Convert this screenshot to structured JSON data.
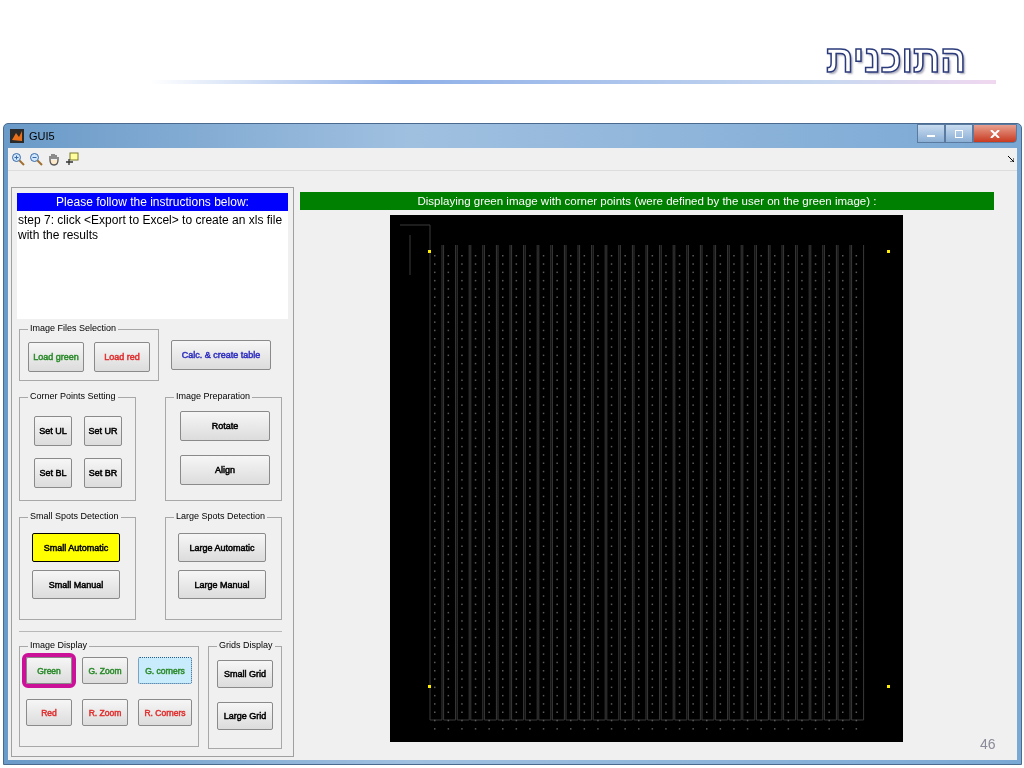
{
  "slide_title": "התוכנית",
  "window": {
    "title": "GUI5"
  },
  "instructions": {
    "header": "Please follow the instructions below:",
    "text": "step 7: click <Export to Excel> to create an xls file with the results"
  },
  "groups": [
    {
      "title": "Image Files Selection",
      "buttons": [
        {
          "label": "Load green",
          "color": "#2e8b2e",
          "kind": "normal"
        },
        {
          "label": "Load red",
          "color": "#e03030",
          "kind": "normal"
        }
      ]
    },
    {
      "buttons": [
        {
          "label": "Calc. & create table",
          "color": "#3030c0",
          "kind": "normal"
        }
      ]
    },
    {
      "title": "Corner Points Setting",
      "buttons": [
        {
          "label": "Set UL",
          "color": "#000000",
          "kind": "normal"
        },
        {
          "label": "Set UR",
          "color": "#000000",
          "kind": "normal"
        },
        {
          "label": "Set BL",
          "color": "#000000",
          "kind": "normal"
        },
        {
          "label": "Set BR",
          "color": "#000000",
          "kind": "normal"
        }
      ]
    },
    {
      "title": "Image Preparation",
      "buttons": [
        {
          "label": "Rotate",
          "color": "#000000",
          "kind": "normal"
        },
        {
          "label": "Align",
          "color": "#000000",
          "kind": "normal"
        }
      ]
    },
    {
      "title": "Small Spots Detection",
      "buttons": [
        {
          "label": "Small Automatic",
          "color": "#000000",
          "kind": "highlighted"
        },
        {
          "label": "Small Manual",
          "color": "#000000",
          "kind": "normal"
        }
      ]
    },
    {
      "title": "Large Spots Detection",
      "buttons": [
        {
          "label": "Large Automatic",
          "color": "#000000",
          "kind": "normal"
        },
        {
          "label": "Large Manual",
          "color": "#000000",
          "kind": "normal"
        }
      ]
    },
    {
      "title": "Image Display",
      "buttons": [
        {
          "label": "Green",
          "color": "#2e8b2e",
          "kind": "selected"
        },
        {
          "label": "G. Zoom",
          "color": "#2e8b2e",
          "kind": "normal"
        },
        {
          "label": "G. corners",
          "color": "#2e8b2e",
          "kind": "focused"
        },
        {
          "label": "Red",
          "color": "#e03030",
          "kind": "normal"
        },
        {
          "label": "R. Zoom",
          "color": "#e03030",
          "kind": "normal"
        },
        {
          "label": "R. Corners",
          "color": "#e03030",
          "kind": "normal"
        }
      ]
    },
    {
      "title": "Grids Display",
      "buttons": [
        {
          "label": "Small Grid",
          "color": "#000000",
          "kind": "normal"
        },
        {
          "label": "Large Grid",
          "color": "#000000",
          "kind": "normal"
        }
      ]
    }
  ],
  "display_header": "Displaying green image with corner points (were defined by the user on the green image) :",
  "slide_number": "46"
}
